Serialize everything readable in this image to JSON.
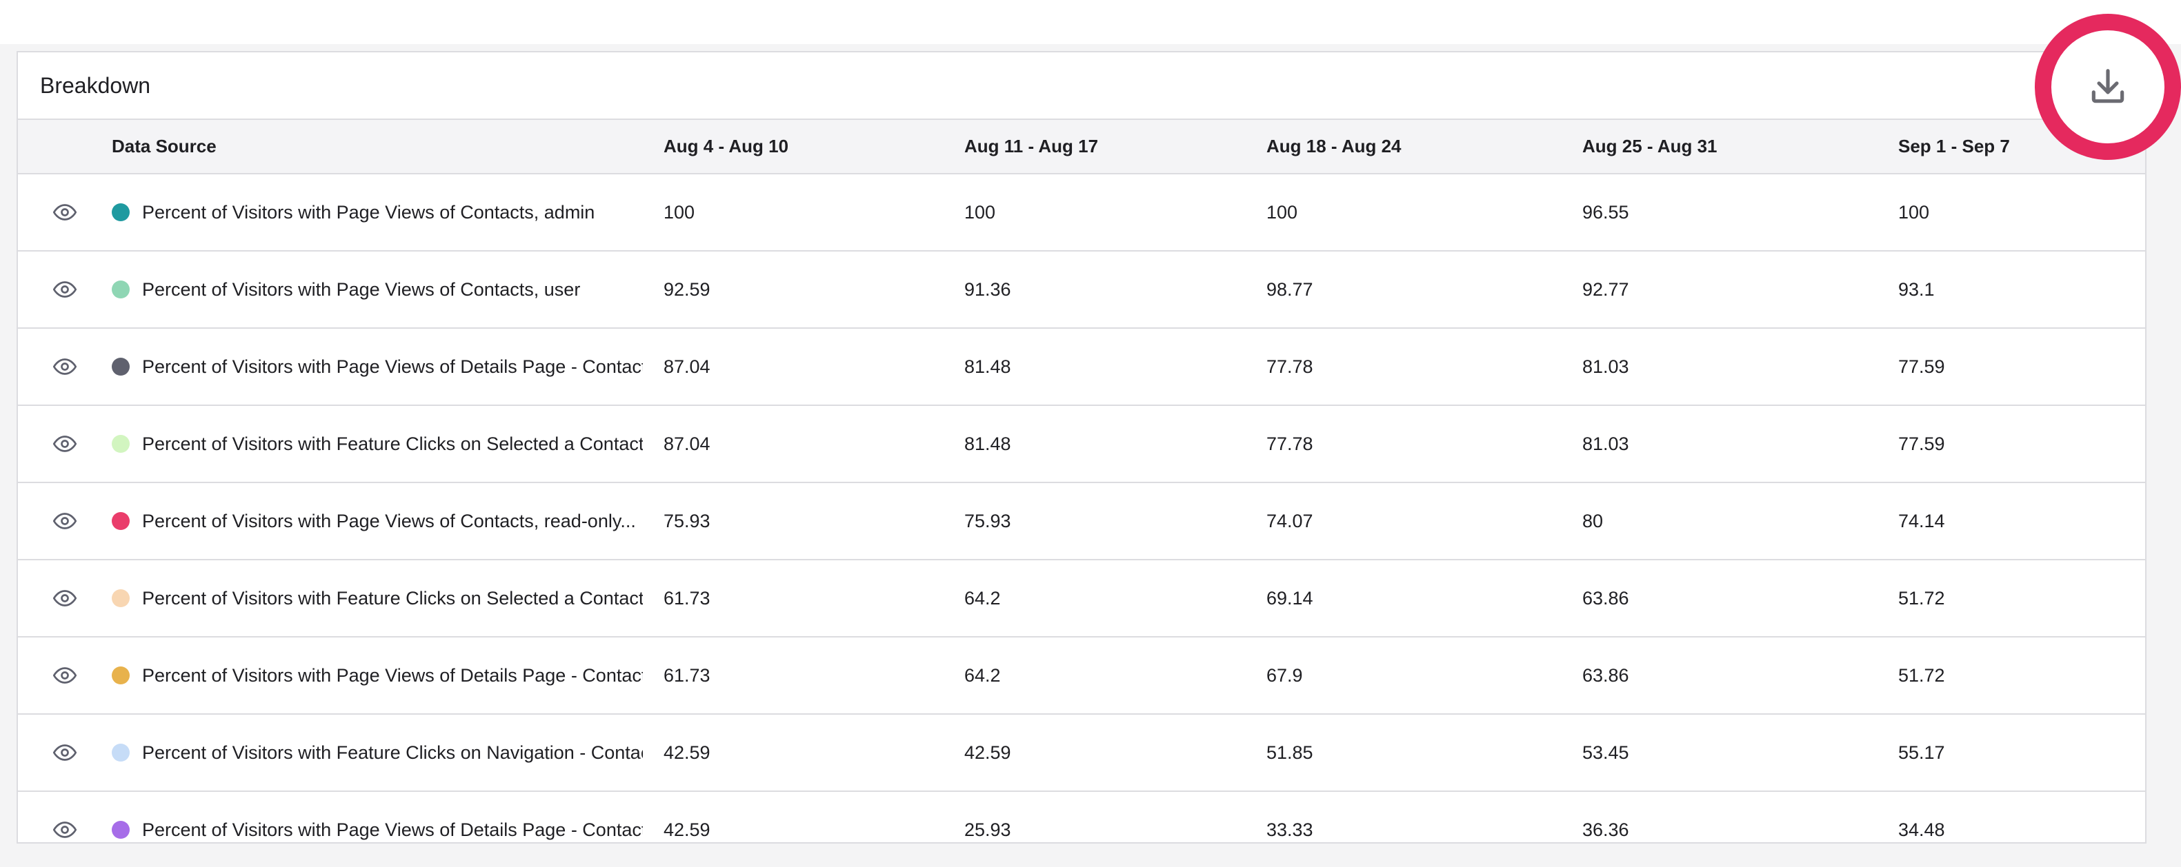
{
  "panel": {
    "title": "Breakdown"
  },
  "table": {
    "headers": {
      "source": "Data Source",
      "cols": [
        "Aug 4 - Aug 10",
        "Aug 11 - Aug 17",
        "Aug 18 - Aug 24",
        "Aug 25 - Aug 31",
        "Sep 1 - Sep 7"
      ]
    },
    "rows": [
      {
        "label": "Percent of Visitors with Page Views of Contacts, admin",
        "color": "#1f9aa0",
        "values": [
          "100",
          "100",
          "100",
          "96.55",
          "100"
        ]
      },
      {
        "label": "Percent of Visitors with Page Views of Contacts, user",
        "color": "#8fd6b4",
        "values": [
          "92.59",
          "91.36",
          "98.77",
          "92.77",
          "93.1"
        ]
      },
      {
        "label": "Percent of Visitors with Page Views of Details Page - Contacts",
        "color": "#5f616e",
        "values": [
          "87.04",
          "81.48",
          "77.78",
          "81.03",
          "77.59"
        ]
      },
      {
        "label": "Percent of Visitors with Feature Clicks on Selected a Contact",
        "color": "#d2f5c0",
        "values": [
          "87.04",
          "81.48",
          "77.78",
          "81.03",
          "77.59"
        ]
      },
      {
        "label": "Percent of Visitors with Page Views of Contacts, read-only...",
        "color": "#ea3d6b",
        "values": [
          "75.93",
          "75.93",
          "74.07",
          "80",
          "74.14"
        ]
      },
      {
        "label": "Percent of Visitors with Feature Clicks on Selected a Contact",
        "color": "#f8d6b2",
        "values": [
          "61.73",
          "64.2",
          "69.14",
          "63.86",
          "51.72"
        ]
      },
      {
        "label": "Percent of Visitors with Page Views of Details Page - Contacts",
        "color": "#e8b24c",
        "values": [
          "61.73",
          "64.2",
          "67.9",
          "63.86",
          "51.72"
        ]
      },
      {
        "label": "Percent of Visitors with Feature Clicks on Navigation - Contacts",
        "color": "#c6dcf7",
        "values": [
          "42.59",
          "42.59",
          "51.85",
          "53.45",
          "55.17"
        ]
      },
      {
        "label": "Percent of Visitors with Page Views of Details Page - Contacts",
        "color": "#a66de8",
        "values": [
          "42.59",
          "25.93",
          "33.33",
          "36.36",
          "34.48"
        ]
      }
    ]
  },
  "icons": {
    "row_toggle": "eye-icon",
    "download": "download-icon"
  },
  "colors": {
    "highlight_ring": "#e5295e"
  }
}
